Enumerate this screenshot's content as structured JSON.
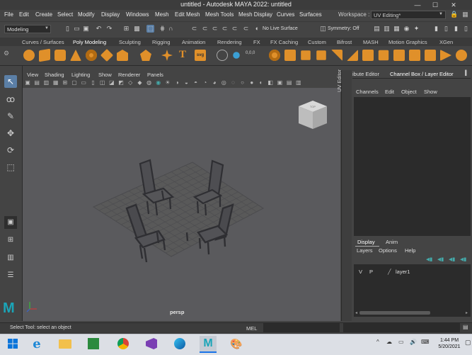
{
  "window": {
    "title": "untitled - Autodesk MAYA 2022: untitled",
    "minimize": "—",
    "maximize": "☐",
    "close": "✕"
  },
  "menubar": [
    "File",
    "Edit",
    "Create",
    "Select",
    "Modify",
    "Display",
    "Windows",
    "Mesh",
    "Edit Mesh",
    "Mesh Tools",
    "Mesh Display",
    "Curves",
    "Surfaces"
  ],
  "workspace": {
    "label": "Workspace :",
    "value": "UV Editing*"
  },
  "statusline": {
    "mode": "Modeling",
    "live_surface": "No Live Surface",
    "symmetry": "Symmetry: Off"
  },
  "shelf_tabs": [
    "Curves / Surfaces",
    "Poly Modeling",
    "Sculpting",
    "Rigging",
    "Animation",
    "Rendering",
    "FX",
    "FX Caching",
    "Custom",
    "Bifrost",
    "MASH",
    "Motion Graphics",
    "XGen"
  ],
  "shelf_active": "Poly Modeling",
  "shelf_text_icons": {
    "svg": "svg",
    "zero": "0,0,0"
  },
  "viewport": {
    "menu": [
      "View",
      "Shading",
      "Lighting",
      "Show",
      "Renderer",
      "Panels"
    ],
    "camera": "persp"
  },
  "uv_editor_label": "UV Editor",
  "right_panel": {
    "tabs": [
      "ibute Editor",
      "Channel Box / Layer Editor"
    ],
    "channel_menu": [
      "Channels",
      "Edit",
      "Object",
      "Show"
    ],
    "layer_tabs": [
      "Display",
      "Anim"
    ],
    "layer_menu": [
      "Layers",
      "Options",
      "Help"
    ],
    "layer": {
      "v": "V",
      "p": "P",
      "name": "layer1"
    }
  },
  "bottom": {
    "help": "Select Tool: select an object",
    "mel": "MEL"
  },
  "taskbar": {
    "time": "1:44 PM",
    "date": "5/20/2021"
  },
  "colors": {
    "maya_logo": "#1aa5b8",
    "selected_tool": "#5b7fa6",
    "shelf_orange": "#e0902a"
  }
}
